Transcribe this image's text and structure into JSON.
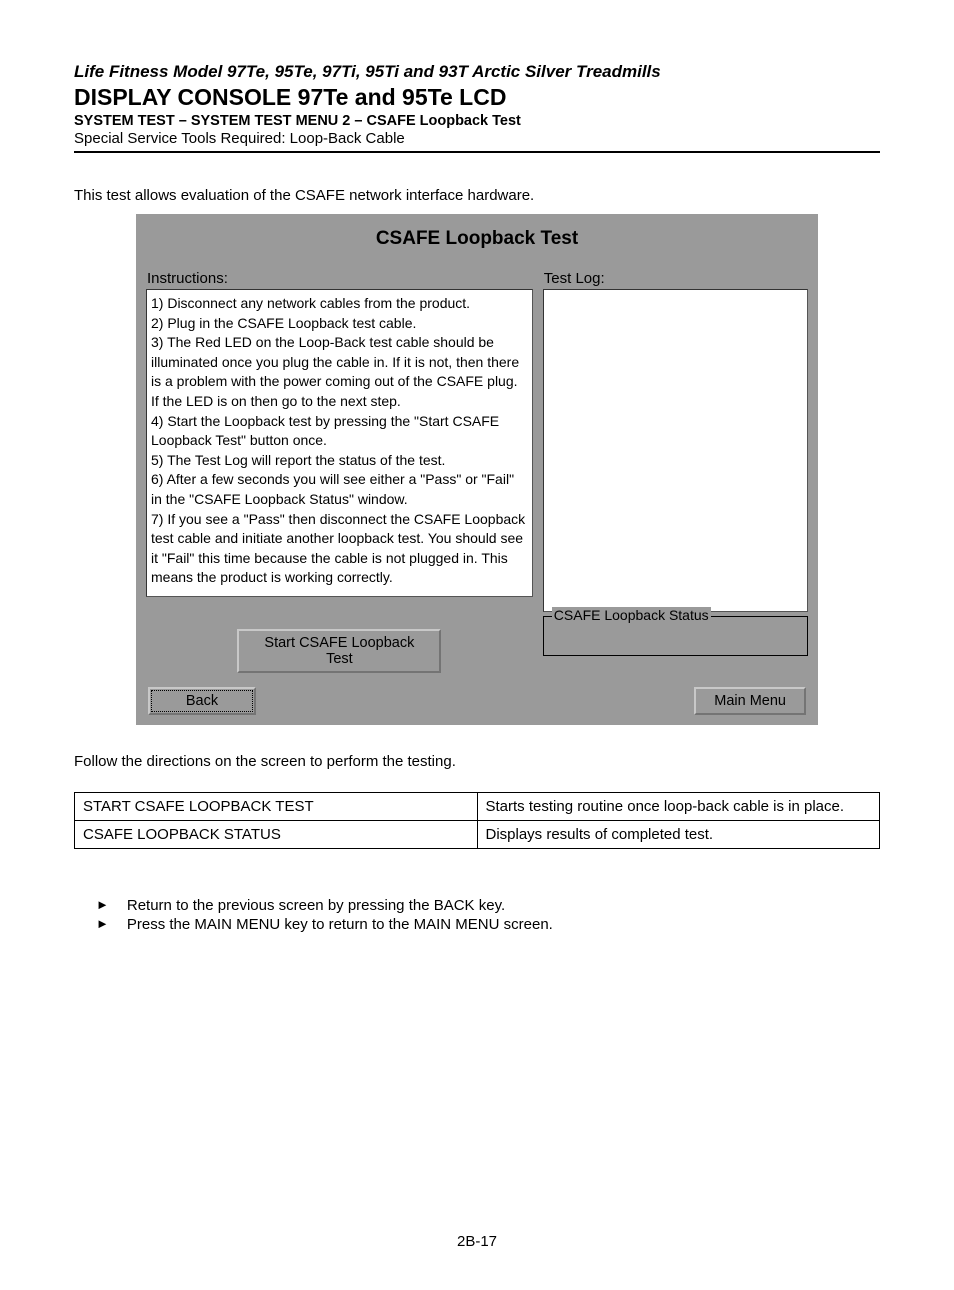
{
  "header": {
    "subtitle": "Life Fitness Model 97Te, 95Te, 97Ti, 95Ti and 93T Arctic Silver Treadmills",
    "title": "DISPLAY CONSOLE 97Te and 95Te LCD",
    "section_path": "SYSTEM TEST – SYSTEM TEST MENU 2 – CSAFE Loopback Test",
    "tools": "Special Service Tools Required: Loop-Back Cable"
  },
  "intro": "This test allows evaluation of the CSAFE network interface hardware.",
  "screen": {
    "title": "CSAFE Loopback Test",
    "instructions_label": "Instructions:",
    "instructions_lines": [
      "1) Disconnect any network cables from the product.",
      "2) Plug in the CSAFE Loopback test cable.",
      "3) The Red LED on the Loop-Back test cable should be illuminated once you plug the cable in.  If it is not, then there is a problem with the power coming out of the CSAFE plug.  If the LED is on then go to the next step.",
      "4) Start the Loopback test by pressing the \"Start CSAFE Loopback Test\" button once.",
      "5) The Test Log will report the status of the test.",
      "6) After a few seconds you will see either a \"Pass\" or \"Fail\" in the \"CSAFE Loopback Status\" window.",
      "7) If you see a \"Pass\" then disconnect the CSAFE Loopback test cable and initiate another loopback test.  You should see it \"Fail\" this time because the cable is not plugged in.  This means the product is working correctly."
    ],
    "testlog_label": "Test Log:",
    "status_legend": "CSAFE Loopback Status",
    "start_button": "Start CSAFE Loopback Test",
    "back_button": "Back",
    "main_menu_button": "Main Menu"
  },
  "follow_text": "Follow the directions on the screen to perform the testing.",
  "table": {
    "rows": [
      {
        "label": "START CSAFE LOOPBACK TEST",
        "desc": "Starts testing routine once loop-back cable is in place."
      },
      {
        "label": "CSAFE LOOPBACK STATUS",
        "desc": "Displays results of completed test."
      }
    ]
  },
  "bullets": [
    "Return to the previous screen by pressing the BACK key.",
    "Press the MAIN MENU key to return to the MAIN MENU screen."
  ],
  "page_number": "2B-17"
}
